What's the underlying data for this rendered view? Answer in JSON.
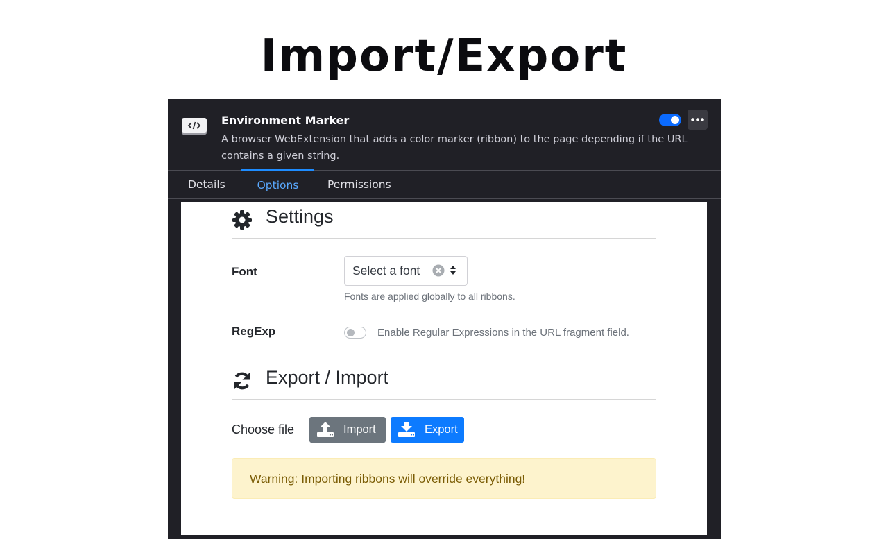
{
  "hero": {
    "title": "Import/Export"
  },
  "addon": {
    "name": "Environment Marker",
    "description": "A browser WebExtension that adds a color marker (ribbon) to the page depending if the URL contains a given string.",
    "enabled": true,
    "icon": "code-icon"
  },
  "tabs": [
    {
      "label": "Details",
      "active": false
    },
    {
      "label": "Options",
      "active": true
    },
    {
      "label": "Permissions",
      "active": false
    }
  ],
  "settings": {
    "title": "Settings",
    "icon": "gear-icon",
    "font": {
      "label": "Font",
      "placeholder": "Select a font",
      "help": "Fonts are applied globally to all ribbons."
    },
    "regexp": {
      "label": "RegExp",
      "enabled": false,
      "description": "Enable Regular Expressions in the URL fragment field."
    }
  },
  "export_import": {
    "title": "Export / Import",
    "icon": "sync-icon",
    "choose_label": "Choose file",
    "import_label": "Import",
    "export_label": "Export",
    "warning": "Warning: Importing ribbons will override everything!"
  },
  "colors": {
    "accent": "#0d7bff",
    "frame": "#202026",
    "warning_bg": "#fdf3cd",
    "warning_text": "#7a5c05"
  }
}
